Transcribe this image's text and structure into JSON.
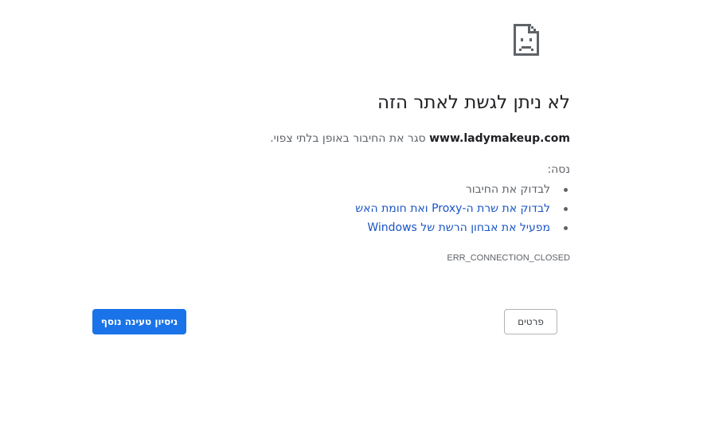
{
  "error": {
    "icon": "sad-page-icon",
    "title": "לא ניתן לגשת לאתר הזה",
    "host": "www.ladymakeup.com",
    "description": "סגר את החיבור באופן בלתי צפוי.",
    "try_label": "נסה:",
    "suggestions": [
      {
        "text": "לבדוק את החיבור",
        "link": false
      },
      {
        "text": "לבדוק את שרת ה-Proxy ואת חומת האש",
        "link": true
      },
      {
        "text": "מפעיל את אבחון הרשת של Windows",
        "link": true
      }
    ],
    "code": "ERR_CONNECTION_CLOSED"
  },
  "buttons": {
    "details_label": "פרטים",
    "reload_label": "ניסיון טעינה נוסף"
  },
  "colors": {
    "accent": "#1a73e8",
    "link": "#1a55c4",
    "text": "#202124",
    "secondary_text": "#5f6368"
  }
}
